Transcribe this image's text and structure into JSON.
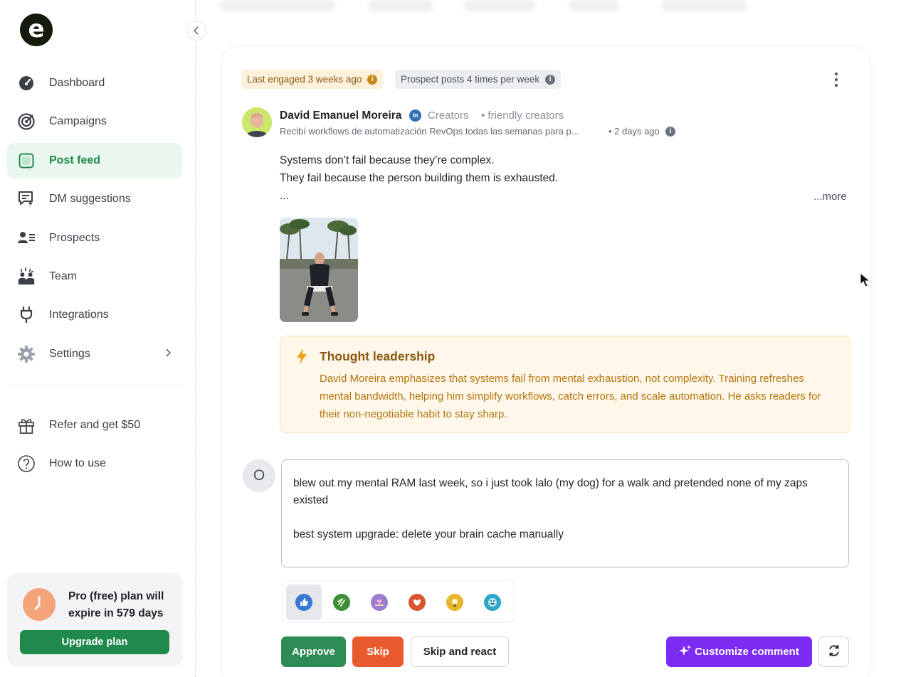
{
  "app": {
    "logo_letter": "e"
  },
  "sidebar": {
    "collapse_icon": "chevron-left-icon",
    "items": [
      {
        "label": "Dashboard",
        "icon": "gauge-icon"
      },
      {
        "label": "Campaigns",
        "icon": "target-icon"
      },
      {
        "label": "Post feed",
        "icon": "feed-icon",
        "active": true
      },
      {
        "label": "DM suggestions",
        "icon": "message-bolt-icon"
      },
      {
        "label": "Prospects",
        "icon": "contact-card-icon"
      },
      {
        "label": "Team",
        "icon": "team-icon"
      },
      {
        "label": "Integrations",
        "icon": "plug-icon"
      },
      {
        "label": "Settings",
        "icon": "gear-icon"
      }
    ],
    "secondary": [
      {
        "label": "Refer and get $50",
        "icon": "gift-icon"
      },
      {
        "label": "How to use",
        "icon": "question-icon"
      }
    ],
    "plan": {
      "text": "Pro (free) plan will expire in 579 days",
      "button": "Upgrade plan"
    }
  },
  "post": {
    "badges": {
      "engaged": "Last engaged 3 weeks ago",
      "frequency": "Prospect posts 4 times per week"
    },
    "author": {
      "name": "David Emanuel Moreira",
      "network_badge": "in",
      "group": "Creators",
      "group_tag": "• friendly creators",
      "headline": "Recibí workflows de automatización RevOps todas las semanas para p...",
      "time": "• 2 days ago"
    },
    "lines": [
      "Systems don’t fail because they’re complex.",
      "They fail because the person building them is exhausted.",
      "..."
    ],
    "more": "...more"
  },
  "insight": {
    "title": "Thought leadership",
    "body": "David Moreira emphasizes that systems fail from mental exhaustion, not complexity. Training refreshes mental bandwidth, helping him simplify workflows, catch errors, and scale automation. He asks readers for their non-negotiable habit to stay sharp."
  },
  "reply": {
    "avatar_letter": "O",
    "paragraphs": [
      "blew out my mental RAM last week, so i just took lalo (my dog) for a walk and pretended none of my zaps existed",
      "",
      "best system upgrade: delete your brain cache manually"
    ]
  },
  "reactions": [
    {
      "name": "like",
      "color": "#3a78d6",
      "selected": true
    },
    {
      "name": "celebrate",
      "color": "#3f8f3a"
    },
    {
      "name": "support",
      "color": "#9a7ed0"
    },
    {
      "name": "love",
      "color": "#d9542f"
    },
    {
      "name": "insightful",
      "color": "#e8b52e"
    },
    {
      "name": "funny",
      "color": "#2fa6c8"
    }
  ],
  "actions": {
    "approve": "Approve",
    "skip": "Skip",
    "skip_react": "Skip and react",
    "customize": "Customize comment"
  },
  "colors": {
    "primary_green": "#1f8a4c",
    "skip_orange": "#ea5a2f",
    "customize_purple": "#7c2bf2",
    "insight_text": "#b4730d"
  }
}
